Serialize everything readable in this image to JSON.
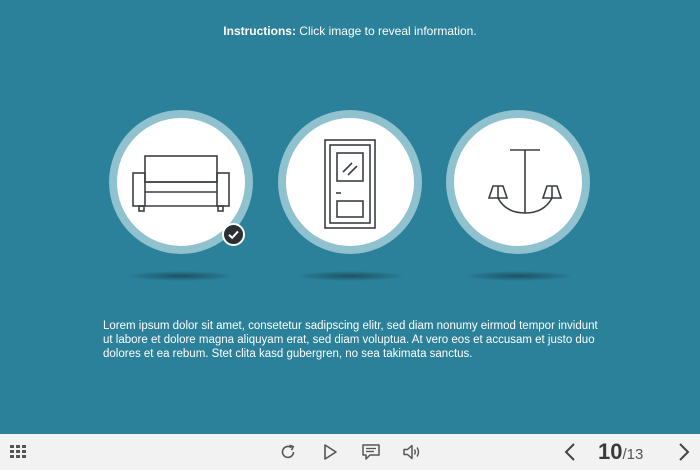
{
  "instructions": {
    "label": "Instructions:",
    "text": " Click image to reveal information."
  },
  "items": [
    {
      "icon": "sofa-icon",
      "viewed": true
    },
    {
      "icon": "door-icon",
      "viewed": false
    },
    {
      "icon": "chandelier-icon",
      "viewed": false
    }
  ],
  "body_text": "Lorem ipsum dolor sit amet, consetetur sadipscing elitr, sed diam nonumy eirmod tempor invidunt ut labore et dolore magna aliquyam erat, sed diam voluptua. At vero eos et accusam et justo duo dolores et ea rebum. Stet clita kasd gubergren, no sea takimata sanctus.",
  "toolbar": {
    "menu_icon": "grid-menu-icon",
    "replay_icon": "replay-icon",
    "play_icon": "play-icon",
    "captions_icon": "captions-icon",
    "audio_icon": "speaker-icon",
    "prev_icon": "chevron-left-icon",
    "next_icon": "chevron-right-icon"
  },
  "pagination": {
    "current": "10",
    "separator": "/",
    "total": "13"
  },
  "colors": {
    "background": "#2a8199",
    "ring": "#8fc1cf",
    "toolbar": "#f2f2f2",
    "badge": "#2b2f33"
  }
}
